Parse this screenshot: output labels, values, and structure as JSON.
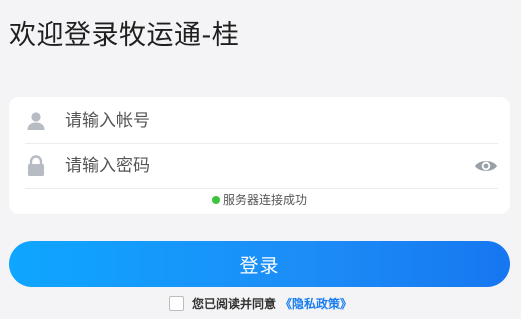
{
  "header": {
    "welcome_text": "欢迎登录牧运通-桂"
  },
  "form": {
    "username_placeholder": "请输入帐号",
    "password_placeholder": "请输入密码",
    "user_icon": "user-icon",
    "lock_icon": "lock-icon",
    "eye_icon": "eye-icon",
    "server_status": "服务器连接成功",
    "server_status_color": "#3cc43a"
  },
  "login": {
    "button_label": "登录",
    "button_color": "#1a8cf5"
  },
  "agreement": {
    "text": "您已阅读并同意",
    "policy_link": "《隐私政策》",
    "checked": false
  }
}
